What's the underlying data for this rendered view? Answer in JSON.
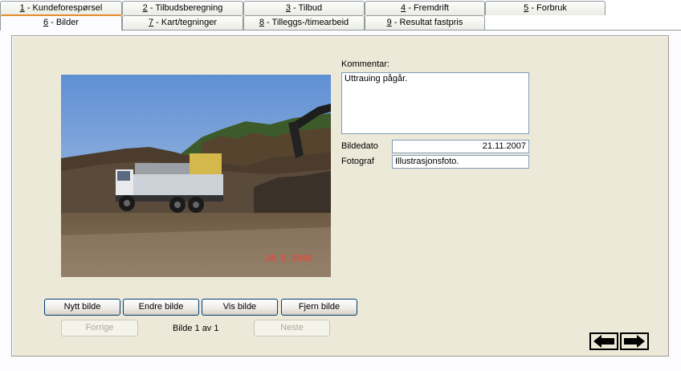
{
  "tabs_row1": [
    {
      "key": "1",
      "label": " - Kundeforespørsel"
    },
    {
      "key": "2",
      "label": " - Tilbudsberegning"
    },
    {
      "key": "3",
      "label": " - Tilbud"
    },
    {
      "key": "4",
      "label": " - Fremdrift"
    },
    {
      "key": "5",
      "label": " - Forbruk"
    }
  ],
  "tabs_row2": [
    {
      "key": "6",
      "label": " - Bilder"
    },
    {
      "key": "7",
      "label": " - Kart/tegninger"
    },
    {
      "key": "8",
      "label": " - Tilleggs-/timearbeid"
    },
    {
      "key": "9",
      "label": " - Resultat fastpris"
    }
  ],
  "active_tab": "6",
  "photo": {
    "date_stamp": "28   5 2002",
    "stamp_color": "#ff3a2a"
  },
  "form": {
    "comment_label": "Kommentar:",
    "comment_value": "Uttrauing pågår.",
    "date_label": "Bildedato",
    "date_value": "21.11.2007",
    "photographer_label": "Fotograf",
    "photographer_value": "Illustrasjonsfoto."
  },
  "buttons": {
    "new": "Nytt bilde",
    "edit": "Endre bilde",
    "show": "Vis bilde",
    "remove": "Fjern bilde",
    "prev": "Forrige",
    "next": "Neste"
  },
  "counter": "Bilde 1 av 1",
  "icons": {
    "back": "arrow-left-icon",
    "forward": "arrow-right-icon"
  }
}
